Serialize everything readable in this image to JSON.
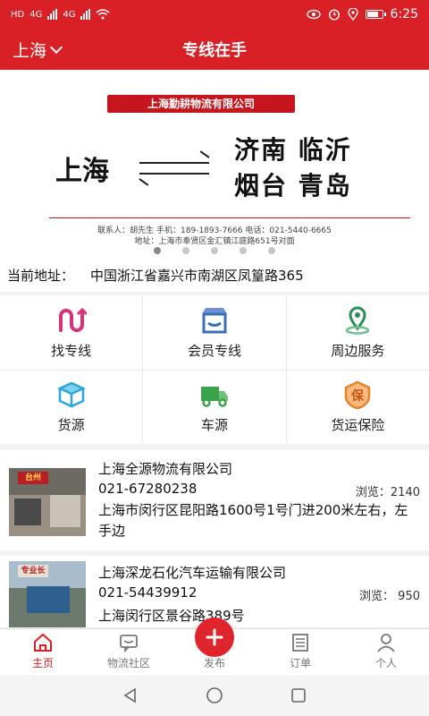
{
  "status_bar": {
    "time": "6:25",
    "network_left": "HD",
    "network_1": "4G",
    "network_2": "4G"
  },
  "header": {
    "city": "上海",
    "title": "专线在手"
  },
  "banner": {
    "company": "上海勤耕物流有限公司",
    "origin": "上海",
    "dest_line1": "济南 临沂",
    "dest_line2": "烟台 青岛",
    "contact_line1": "联系人：胡先生    手机：189-1893-7666    电话：021-5440-6665",
    "contact_line2": "地址：上海市奉贤区金汇镇江庭路651号对面",
    "total_slides": 5,
    "active_slide": 1
  },
  "location": {
    "label": "当前地址：",
    "value": "中国浙江省嘉兴市南湖区凤篁路365"
  },
  "services": [
    {
      "label": "找专线",
      "icon": "route-icon",
      "color": "#d6337a"
    },
    {
      "label": "会员专线",
      "icon": "store-icon",
      "color": "#3a6fb5"
    },
    {
      "label": "周边服务",
      "icon": "location-pin-icon",
      "color": "#2e8b57"
    },
    {
      "label": "货源",
      "icon": "box-icon",
      "color": "#2fa6d6"
    },
    {
      "label": "车源",
      "icon": "truck-icon",
      "color": "#3aa34a"
    },
    {
      "label": "货运保险",
      "icon": "insurance-icon",
      "color": "#e8822a"
    }
  ],
  "listings": [
    {
      "company": "上海全源物流有限公司",
      "phone": "021-67280238",
      "views": "浏览：2140",
      "address": "上海市闵行区昆阳路1600号1号门进200米左右，左手边",
      "thumb_sign": "台州"
    },
    {
      "company": "上海深龙石化汽车运输有限公司",
      "phone": "021-54439912",
      "views": "浏览：  950",
      "address": "上海闵行区景谷路389号",
      "thumb_sign": "专业长"
    }
  ],
  "tabbar": {
    "home": "主页",
    "community": "物流社区",
    "publish": "发布",
    "orders": "订单",
    "profile": "个人"
  },
  "colors": {
    "brand": "#d92027",
    "tab_inactive": "#777777"
  }
}
